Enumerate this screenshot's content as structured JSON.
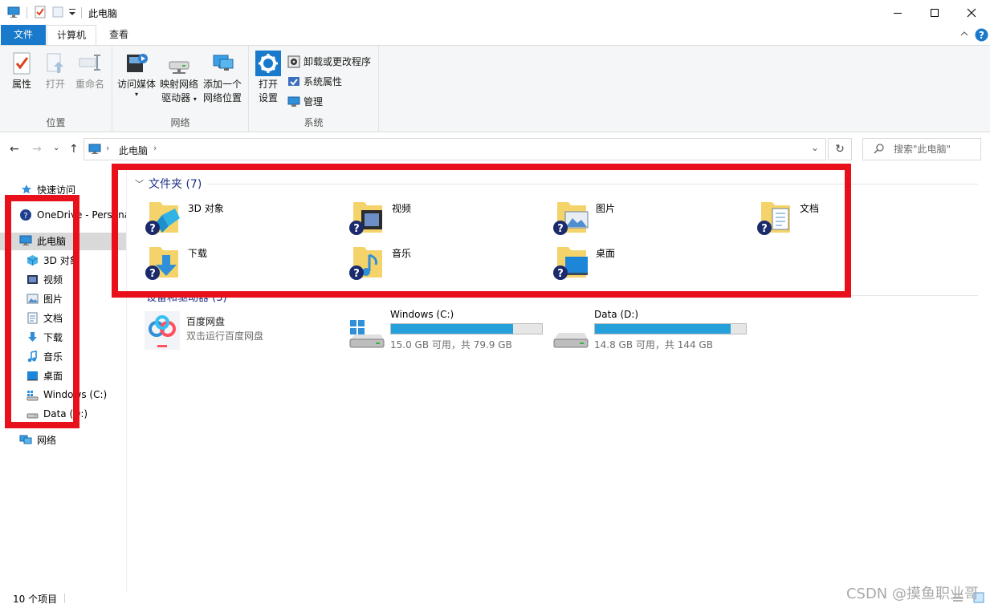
{
  "window": {
    "title": "此电脑",
    "controls": {
      "minimize": "minimize-icon",
      "maximize": "maximize-icon",
      "close": "close-icon"
    }
  },
  "ribbon": {
    "tabs": [
      "文件",
      "计算机",
      "查看"
    ],
    "groups": {
      "location": {
        "label": "位置",
        "buttons": [
          "属性",
          "打开",
          "重命名"
        ]
      },
      "network": {
        "label": "网络",
        "access_media": "访问媒体",
        "map_drive_line1": "映射网络",
        "map_drive_line2": "驱动器",
        "add_location_line1": "添加一个",
        "add_location_line2": "网络位置"
      },
      "system": {
        "label": "系统",
        "open_settings_line1": "打开",
        "open_settings_line2": "设置",
        "uninstall": "卸载或更改程序",
        "system_properties": "系统属性",
        "manage": "管理"
      }
    }
  },
  "address": {
    "path": "此电脑",
    "search_placeholder": "搜索\"此电脑\""
  },
  "nav": {
    "items": [
      {
        "label": "快速访问",
        "icon": "star-icon"
      },
      {
        "label": "OneDrive - Persona",
        "icon": "onedrive-icon"
      },
      {
        "label": "此电脑",
        "icon": "computer-icon"
      },
      {
        "label": "3D 对象",
        "icon": "3d-objects-icon"
      },
      {
        "label": "视频",
        "icon": "video-icon"
      },
      {
        "label": "图片",
        "icon": "pictures-icon"
      },
      {
        "label": "文档",
        "icon": "documents-icon"
      },
      {
        "label": "下载",
        "icon": "downloads-icon"
      },
      {
        "label": "音乐",
        "icon": "music-icon"
      },
      {
        "label": "桌面",
        "icon": "desktop-icon"
      },
      {
        "label": "Windows (C:)",
        "icon": "windows-drive-icon"
      },
      {
        "label": "Data (D:)",
        "icon": "drive-icon"
      },
      {
        "label": "网络",
        "icon": "network-icon"
      }
    ]
  },
  "content": {
    "folders_header": "文件夹 (7)",
    "folders": [
      "3D 对象",
      "视频",
      "图片",
      "文档",
      "下载",
      "音乐",
      "桌面"
    ],
    "devices_header": "设备和驱动器 (3)",
    "app": {
      "name": "百度网盘",
      "subtitle": "双击运行百度网盘"
    },
    "drives": [
      {
        "name": "Windows (C:)",
        "free": "15.0 GB 可用，共 79.9 GB",
        "used_fraction": 0.81
      },
      {
        "name": "Data (D:)",
        "free": "14.8 GB 可用，共 144 GB",
        "used_fraction": 0.9
      }
    ]
  },
  "status": {
    "item_count": "10 个项目"
  },
  "watermark": "CSDN @摸鱼职业哥",
  "colors": {
    "accent": "#1979ca",
    "highlight": "#e8111b",
    "drive_fill": "#26a0da",
    "folder": "#f4d36b"
  }
}
